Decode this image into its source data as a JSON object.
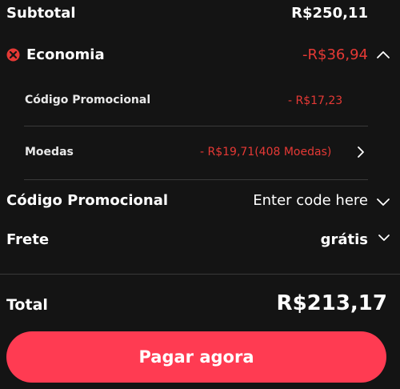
{
  "subtotal": {
    "label": "Subtotal",
    "value": "R$250,11"
  },
  "savings": {
    "label": "Economia",
    "value": "-R$36,94",
    "promo": {
      "label": "Código Promocional",
      "value": "- R$17,23"
    },
    "coins": {
      "label": "Moedas",
      "value": "- R$19,71(408 Moedas)"
    }
  },
  "promo_code": {
    "label": "Código Promocional",
    "placeholder": "Enter code here"
  },
  "shipping": {
    "label": "Frete",
    "value": "grátis"
  },
  "total": {
    "label": "Total",
    "value": "R$213,17"
  },
  "pay_button": {
    "label": "Pagar agora"
  },
  "colors": {
    "accent_red": "#e53935",
    "button": "#ff3b52",
    "background": "#141414"
  },
  "icons": [
    "economy-badge-icon",
    "chevron-up-icon",
    "chevron-right-icon",
    "chevron-down-icon"
  ]
}
